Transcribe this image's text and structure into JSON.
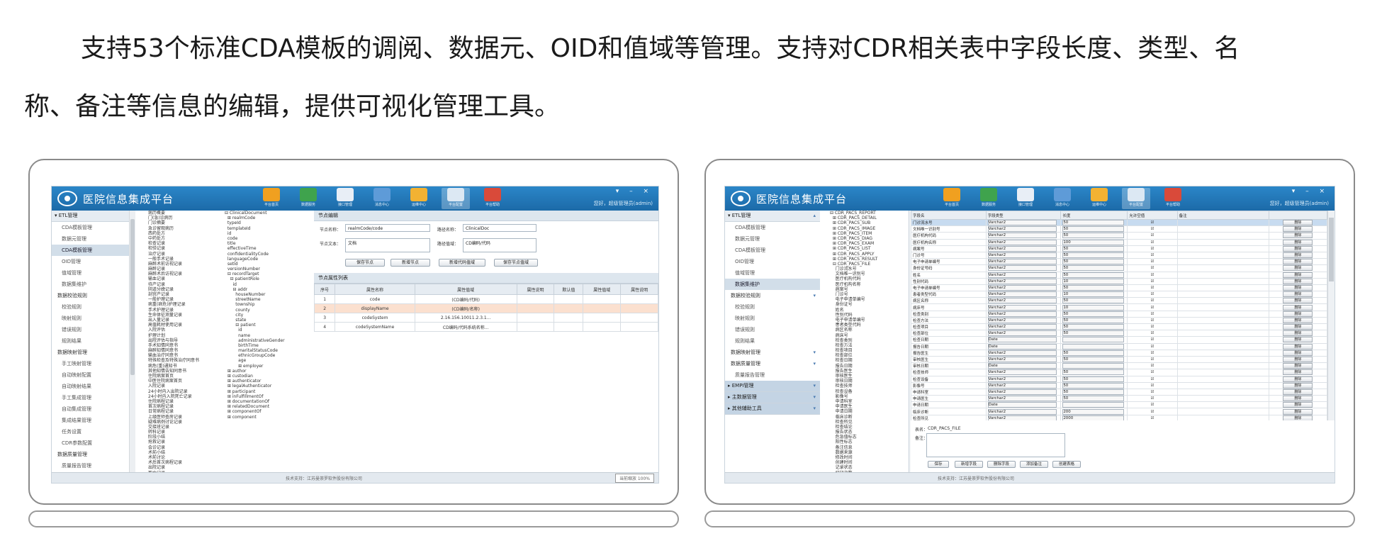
{
  "paragraph": {
    "line1": "支持53个标准CDA模板的调阅、数据元、OID和值域等管理。支持对CDR相关表中字段长度、类型、名",
    "line2": "称、备注等信息的编辑，提供可视化管理工具。"
  },
  "colors": {
    "titlebar": "#1c6aa8",
    "highlight_row": "#fbe0cf",
    "selected_row": "#c7dbf0"
  },
  "left_app": {
    "title": "医院信息集成平台",
    "user_info": "您好，超级管理员(admin)",
    "window_controls": "▾ – ×",
    "toolbar": [
      {
        "label": "平台首页",
        "icon": "home-icon",
        "color": "#f0a020"
      },
      {
        "label": "数据服务",
        "icon": "grid-icon",
        "color": "#3fa34d"
      },
      {
        "label": "接口管理",
        "icon": "document-icon",
        "color": "#e8eef6"
      },
      {
        "label": "消息中心",
        "icon": "monitor-icon",
        "color": "#5e9bd8"
      },
      {
        "label": "运维中心",
        "icon": "folder-icon",
        "color": "#f2b233"
      },
      {
        "label": "平台配置",
        "icon": "config-icon",
        "color": "#dce8f3",
        "active": true
      },
      {
        "label": "平台帮助",
        "icon": "help-icon",
        "color": "#d94a3a"
      }
    ],
    "nav": [
      {
        "type": "section",
        "label": "▾ ETL管理"
      },
      {
        "type": "item",
        "label": "CDA模板管理"
      },
      {
        "type": "item",
        "label": "数据元管理"
      },
      {
        "type": "item",
        "label": "CDA模板管理",
        "selected": true
      },
      {
        "type": "item",
        "label": "OID管理"
      },
      {
        "type": "item",
        "label": "值域管理"
      },
      {
        "type": "item",
        "label": "数据集维护"
      },
      {
        "type": "group",
        "label": "数据校验规则"
      },
      {
        "type": "item",
        "label": "校验规则"
      },
      {
        "type": "item",
        "label": "映射规则"
      },
      {
        "type": "item",
        "label": "错误规则"
      },
      {
        "type": "item",
        "label": "规则结果"
      },
      {
        "type": "group",
        "label": "数据映射管理"
      },
      {
        "type": "item",
        "label": "手工映射管理"
      },
      {
        "type": "item",
        "label": "自动映射配置"
      },
      {
        "type": "item",
        "label": "自动映射结果"
      },
      {
        "type": "item",
        "label": "手工集成管理"
      },
      {
        "type": "item",
        "label": "自动集成管理"
      },
      {
        "type": "item",
        "label": "集成结果管理"
      },
      {
        "type": "item",
        "label": "任务设置"
      },
      {
        "type": "item",
        "label": "CDR参数配置"
      },
      {
        "type": "group",
        "label": "数据质量管理"
      },
      {
        "type": "item",
        "label": "质量报告管理"
      }
    ],
    "tree1": [
      "病历概要",
      "门(急)诊病历",
      "门诊摘要",
      "急诊留观病历",
      "西药处方",
      "中药处方",
      "检查记录",
      "检验记录",
      "治疗记录",
      "一般手术记录",
      "麻醉术前访视记录",
      "麻醉记录",
      "麻醉术后访视记录",
      "输血记录",
      "待产记录",
      "阴道分娩记录",
      "剖宫产记录",
      "一般护理记录",
      "病重(病危)护理记录",
      "手术护理记录",
      "生命体征测量记录",
      "出入量记录",
      "高值耗材使用记录",
      "入院评估",
      "护理计划",
      "出院评估与指导",
      "手术知情同意书",
      "麻醉知情同意书",
      "输血治疗同意书",
      "特殊检查及特殊治疗同意书",
      "病危(重)通知书",
      "其他知情告知同意书",
      "住院病案首页",
      "中医住院病案首页",
      "入院记录",
      "24小时内入出院记录",
      "24小时内入院死亡记录",
      "住院病程记录",
      "首次病程记录",
      "日常病程记录",
      "上级医师查房记录",
      "疑难病例讨论记录",
      "交接班记录",
      "转科记录",
      "阶段小结",
      "抢救记录",
      "会诊记录",
      "术前小结",
      "术前讨论",
      "术后首次病程记录",
      "出院记录",
      "死亡记录",
      "死亡病例讨论记录"
    ],
    "tree2": [
      "⊟ ClinicalDocument",
      "  ⊞ realmCode",
      "  typeId",
      "  templateId",
      "  id",
      "  code",
      "  title",
      "  effectiveTime",
      "  confidentialityCode",
      "  languageCode",
      "  setId",
      "  versionNumber",
      "  ⊟ recordTarget",
      "    ⊟ patientRole",
      "      id",
      "      ⊟ addr",
      "        houseNumber",
      "        streetName",
      "        township",
      "        county",
      "        city",
      "        state",
      "        ⊟ patient",
      "          id",
      "          name",
      "          administrativeGender",
      "          birthTime",
      "          maritalStatusCode",
      "          ethnicGroupCode",
      "          age",
      "          ⊞ employer",
      "  ⊞ author",
      "  ⊞ custodian",
      "  ⊞ authenticator",
      "  ⊞ legalAuthenticator",
      "  ⊞ participant",
      "  ⊞ inFulfillmentOf",
      "  ⊞ documentationOf",
      "  ⊞ relatedDocument",
      "  ⊞ componentOf",
      "  ⊞ component"
    ],
    "form": {
      "title": "节点编辑",
      "node_name_label": "节点名称：",
      "node_name_value": "realmCode/code",
      "path_name_label": "路径名称：",
      "path_name_value": "ClinicalDoc",
      "node_text_label": "节点文本：",
      "node_text_value": "文档",
      "path_value_label": "路径值域：",
      "path_value_value": "CD编码/代码"
    },
    "buttons": [
      "保存节点",
      "新增节点",
      "新增代码值域",
      "保存节点值域"
    ],
    "table": {
      "title": "节点属性列表",
      "headers": [
        "序号",
        "属性名称",
        "属性值域",
        "属性说明",
        "默认值",
        "属性值域",
        "属性说明"
      ],
      "rows": [
        [
          "1",
          "code",
          "(CD编码/代码)",
          "",
          "",
          "",
          ""
        ],
        [
          "2",
          "displayName",
          "(CD编码/名称)",
          "",
          "",
          "",
          ""
        ],
        [
          "3",
          "codeSystem",
          "2.16.156.10011.2.3.1...",
          "",
          "",
          "",
          ""
        ],
        [
          "4",
          "codeSystemName",
          "CD编码/代码系统名称...",
          "",
          "",
          "",
          ""
        ]
      ]
    },
    "status_support": "技术支持：江苏曼荼罗软件股份有限公司",
    "zoom": "当前缩放 100%"
  },
  "right_app": {
    "title": "医院信息集成平台",
    "user_info": "您好，超级管理员(admin)",
    "window_controls": "▾ – ×",
    "toolbar": [
      {
        "label": "平台首页",
        "icon": "home-icon",
        "color": "#f0a020"
      },
      {
        "label": "数据服务",
        "icon": "grid-icon",
        "color": "#3fa34d"
      },
      {
        "label": "接口管理",
        "icon": "document-icon",
        "color": "#e8eef6"
      },
      {
        "label": "消息中心",
        "icon": "monitor-icon",
        "color": "#5e9bd8"
      },
      {
        "label": "运维中心",
        "icon": "folder-icon",
        "color": "#f2b233"
      },
      {
        "label": "平台配置",
        "icon": "config-icon",
        "color": "#dce8f3",
        "active": true
      },
      {
        "label": "平台帮助",
        "icon": "help-icon",
        "color": "#d94a3a"
      }
    ],
    "nav": [
      {
        "type": "section",
        "label": "▾ ETL管理",
        "arrow": "▴"
      },
      {
        "type": "item",
        "label": "CDA模板管理"
      },
      {
        "type": "item",
        "label": "数据元管理"
      },
      {
        "type": "item",
        "label": "CDA模板管理"
      },
      {
        "type": "item",
        "label": "OID管理"
      },
      {
        "type": "item",
        "label": "值域管理"
      },
      {
        "type": "item",
        "label": "数据集维护",
        "selected": true
      },
      {
        "type": "group",
        "label": "数据校验规则",
        "arrow": "▾"
      },
      {
        "type": "item",
        "label": "校验规则"
      },
      {
        "type": "item",
        "label": "映射规则"
      },
      {
        "type": "item",
        "label": "错误规则"
      },
      {
        "type": "item",
        "label": "规则结果"
      },
      {
        "type": "group",
        "label": "数据映射管理",
        "arrow": "▾"
      },
      {
        "type": "group",
        "label": "数据质量管理",
        "arrow": "▾"
      },
      {
        "type": "item",
        "label": "质量报告管理"
      },
      {
        "type": "section-blue",
        "label": "▸ EMPI管理",
        "arrow": "▾"
      },
      {
        "type": "section-blue",
        "label": "▸ 主数据管理",
        "arrow": "▾"
      },
      {
        "type": "section-blue",
        "label": "▸ 其他辅助工具",
        "arrow": "▾"
      }
    ],
    "tree": [
      "⊟ CDR_PACS_REPORT",
      "  ⊞ CDR_PACS_DETAIL",
      "  ⊞ CDR_PACS_SUB",
      "  ⊞ CDR_PACS_IMAGE",
      "  ⊞ CDR_PACS_ITEM",
      "  ⊞ CDR_PACS_DIAG",
      "  ⊞ CDR_PACS_EXAM",
      "  ⊞ CDR_PACS_LIST",
      "  ⊞ CDR_PACS_APPLY",
      "  ⊞ CDR_PACS_RESULT",
      "  ⊟ CDR_PACS_FILE",
      "    门诊流水号",
      "    文档唯一识别号",
      "    医疗机构代码",
      "    医疗机构名称",
      "    病案号",
      "    门诊号",
      "    电子申请单编号",
      "    身份证号",
      "    姓名",
      "    性别代码",
      "    电子申请单编号",
      "    患者类型代码",
      "    病区名称",
      "    病床号",
      "    检查类别",
      "    检查方法",
      "    检查项目",
      "    检查部位",
      "    检查日期",
      "    报告日期",
      "    报告医生",
      "    审核医生",
      "    审核日期",
      "    检查技师",
      "    检查设备",
      "    影像号",
      "    申请科室",
      "    申请医生",
      "    申请日期",
      "    临床诊断",
      "    检查所见",
      "    检查结论",
      "    报告状态",
      "    危急值标志",
      "    阳性标志",
      "    备注信息",
      "    数据来源",
      "    修改时间",
      "    创建时间",
      "    记录状态",
      "    打印次数",
      "    输出标识",
      "    影像路径",
      "    影像数量",
      "    检查费用",
      "    收费状态",
      "    预约日期",
      "    预约时间",
      "    登记日期",
      "    登记人员",
      "    诊断编码",
      "    诊断名称",
      "    ICD编码",
      "    检查编码",
      "    设备编码",
      "    输出时间",
      "    输出人员",
      "    输出状态",
      "    输出备注",
      "    扩展字段1",
      "    扩展字段2"
    ],
    "grid_headers": [
      "字段名",
      "字段类型",
      "长度",
      "允许空值",
      "备注",
      ""
    ],
    "grid_rows": [
      [
        "门诊流水号",
        "Varchar2",
        "50",
        "☑",
        "",
        "删除"
      ],
      [
        "文档唯一识别号",
        "Varchar2",
        "50",
        "☑",
        "",
        "删除"
      ],
      [
        "医疗机构代码",
        "Varchar2",
        "50",
        "☑",
        "",
        "删除"
      ],
      [
        "医疗机构名称",
        "Varchar2",
        "100",
        "☑",
        "",
        "删除"
      ],
      [
        "病案号",
        "Varchar2",
        "50",
        "☑",
        "",
        "删除"
      ],
      [
        "门诊号",
        "Varchar2",
        "50",
        "☑",
        "",
        "删除"
      ],
      [
        "电子申请单编号",
        "Varchar2",
        "50",
        "☑",
        "",
        "删除"
      ],
      [
        "身份证号码",
        "Varchar2",
        "50",
        "☑",
        "",
        "删除"
      ],
      [
        "姓名",
        "Varchar2",
        "50",
        "☑",
        "",
        "删除"
      ],
      [
        "性别代码",
        "Varchar2",
        "10",
        "☑",
        "",
        "删除"
      ],
      [
        "电子申请单编号",
        "Varchar2",
        "50",
        "☑",
        "",
        "删除"
      ],
      [
        "患者类型代码",
        "Varchar2",
        "10",
        "☑",
        "",
        "删除"
      ],
      [
        "病区名称",
        "Varchar2",
        "50",
        "☑",
        "",
        "删除"
      ],
      [
        "病床号",
        "Varchar2",
        "10",
        "☑",
        "",
        "删除"
      ],
      [
        "检查类别",
        "Varchar2",
        "50",
        "☑",
        "",
        "删除"
      ],
      [
        "检查方法",
        "Varchar2",
        "50",
        "☑",
        "",
        "删除"
      ],
      [
        "检查项目",
        "Varchar2",
        "50",
        "☑",
        "",
        "删除"
      ],
      [
        "检查部位",
        "Varchar2",
        "50",
        "☑",
        "",
        "删除"
      ],
      [
        "检查日期",
        "Date",
        "",
        "☑",
        "",
        "删除"
      ],
      [
        "报告日期",
        "Date",
        "",
        "☑",
        "",
        "删除"
      ],
      [
        "报告医生",
        "Varchar2",
        "50",
        "☑",
        "",
        "删除"
      ],
      [
        "审核医生",
        "Varchar2",
        "50",
        "☑",
        "",
        "删除"
      ],
      [
        "审核日期",
        "Date",
        "",
        "☑",
        "",
        "删除"
      ],
      [
        "检查技师",
        "Varchar2",
        "50",
        "☑",
        "",
        "删除"
      ],
      [
        "检查设备",
        "Varchar2",
        "50",
        "☑",
        "",
        "删除"
      ],
      [
        "影像号",
        "Varchar2",
        "50",
        "☑",
        "",
        "删除"
      ],
      [
        "申请科室",
        "Varchar2",
        "50",
        "☑",
        "",
        "删除"
      ],
      [
        "申请医生",
        "Varchar2",
        "50",
        "☑",
        "",
        "删除"
      ],
      [
        "申请日期",
        "Date",
        "",
        "☑",
        "",
        "删除"
      ],
      [
        "临床诊断",
        "Varchar2",
        "200",
        "☑",
        "",
        "删除"
      ],
      [
        "检查所见",
        "Varchar2",
        "2000",
        "☑",
        "",
        "删除"
      ],
      [
        "检查结论",
        "Varchar2",
        "2000",
        "☑",
        "",
        "删除"
      ],
      [
        "报告状态",
        "Varchar2",
        "10",
        "☑",
        "",
        "删除"
      ],
      [
        "危急值标志",
        "Varchar2",
        "10",
        "☑",
        "",
        "删除"
      ]
    ],
    "table_name_label": "表名：",
    "table_name_value": "CDR_PACS_FILE",
    "remark_label": "备注：",
    "buttons": [
      "保存",
      "新增字段",
      "删除字段",
      "添加备注",
      "创建表格"
    ],
    "status_support": "技术支持：江苏曼荼罗软件股份有限公司"
  }
}
